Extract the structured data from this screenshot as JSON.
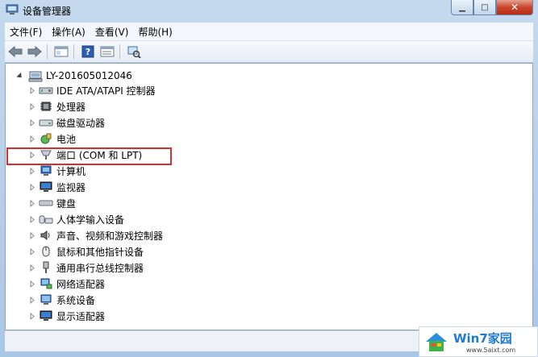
{
  "window": {
    "title": "设备管理器"
  },
  "menu": [
    "文件(F)",
    "操作(A)",
    "查看(V)",
    "帮助(H)"
  ],
  "tree": {
    "root": "LY-201605012046",
    "items": [
      {
        "label": "IDE ATA/ATAPI 控制器",
        "icon": "ide-controller-icon"
      },
      {
        "label": "处理器",
        "icon": "processor-icon"
      },
      {
        "label": "磁盘驱动器",
        "icon": "disk-drive-icon"
      },
      {
        "label": "电池",
        "icon": "battery-icon"
      },
      {
        "label": "端口 (COM 和 LPT)",
        "icon": "port-icon"
      },
      {
        "label": "计算机",
        "icon": "computer-icon"
      },
      {
        "label": "监视器",
        "icon": "monitor-icon"
      },
      {
        "label": "键盘",
        "icon": "keyboard-icon"
      },
      {
        "label": "人体学输入设备",
        "icon": "hid-icon"
      },
      {
        "label": "声音、视频和游戏控制器",
        "icon": "sound-icon"
      },
      {
        "label": "鼠标和其他指针设备",
        "icon": "mouse-icon"
      },
      {
        "label": "通用串行总线控制器",
        "icon": "usb-icon"
      },
      {
        "label": "网络适配器",
        "icon": "network-adapter-icon"
      },
      {
        "label": "系统设备",
        "icon": "system-device-icon"
      },
      {
        "label": "显示适配器",
        "icon": "display-adapter-icon"
      }
    ]
  },
  "watermark": {
    "title": "Win7家园",
    "url": "www.5aixt.com"
  },
  "colors": {
    "highlight": "#d6302c",
    "accent": "#1f7ad3"
  }
}
